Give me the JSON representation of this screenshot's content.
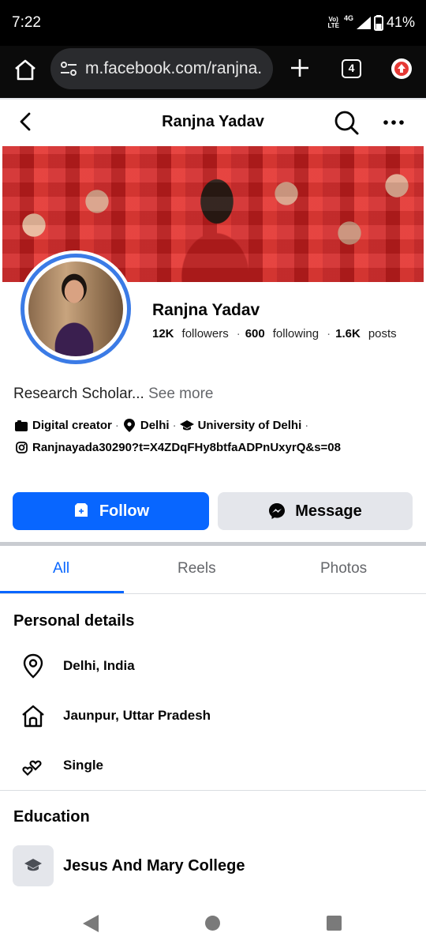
{
  "status_bar": {
    "time": "7:22",
    "network_line1": "Vo)",
    "network_line2": "LTE",
    "network": "4G",
    "battery": "41%"
  },
  "browser": {
    "url": "m.facebook.com/ranjna.",
    "tab_count": "4"
  },
  "header": {
    "title": "Ranjna Yadav"
  },
  "profile": {
    "name": "Ranjna Yadav",
    "followers_count": "12K",
    "followers_label": "followers",
    "following_count": "600",
    "following_label": "following",
    "posts_count": "1.6K",
    "posts_label": "posts",
    "bio": "Research Scholar...",
    "see_more": "See more",
    "category": "Digital creator",
    "location": "Delhi",
    "education": "University of Delhi",
    "instagram": "Ranjnayada30290?t=X4ZDqFHy8btfaADPnUxyrQ&s=08"
  },
  "actions": {
    "follow": "Follow",
    "message": "Message"
  },
  "tabs": [
    {
      "label": "All",
      "active": true
    },
    {
      "label": "Reels",
      "active": false
    },
    {
      "label": "Photos",
      "active": false
    }
  ],
  "personal_details": {
    "title": "Personal details",
    "items": [
      {
        "icon": "location-pin-icon",
        "text": "Delhi, India"
      },
      {
        "icon": "home-icon",
        "text": "Jaunpur, Uttar Pradesh"
      },
      {
        "icon": "hearts-icon",
        "text": "Single"
      }
    ]
  },
  "education_section": {
    "title": "Education",
    "items": [
      {
        "icon": "graduation-cap-icon",
        "text": "Jesus And Mary College"
      }
    ]
  },
  "colors": {
    "accent": "#0866ff",
    "avatar_ring": "#3b7be6"
  }
}
